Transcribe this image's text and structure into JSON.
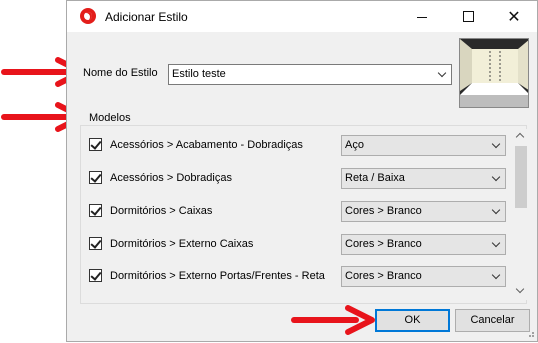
{
  "window": {
    "title": "Adicionar Estilo"
  },
  "titlebar_buttons": {
    "minimize": "—",
    "maximize": "□",
    "close": "✕"
  },
  "style_name": {
    "label": "Nome do Estilo",
    "value": "Estilo teste"
  },
  "models": {
    "group_label": "Modelos",
    "rows": [
      {
        "label": "Acessórios > Acabamento - Dobradiças",
        "checked": true,
        "option": "Aço"
      },
      {
        "label": "Acessórios > Dobradiças",
        "checked": true,
        "option": "Reta / Baixa"
      },
      {
        "label": "Dormitórios > Caixas",
        "checked": true,
        "option": "Cores > Branco"
      },
      {
        "label": "Dormitórios > Externo Caixas",
        "checked": true,
        "option": "Cores > Branco"
      },
      {
        "label": "Dormitórios > Externo Portas/Frentes - Reta",
        "checked": true,
        "option": "Cores > Branco"
      }
    ]
  },
  "buttons": {
    "ok": "OK",
    "cancel": "Cancelar"
  },
  "colors": {
    "annotation_arrow": "#e8141b",
    "accent": "#0078d7"
  }
}
